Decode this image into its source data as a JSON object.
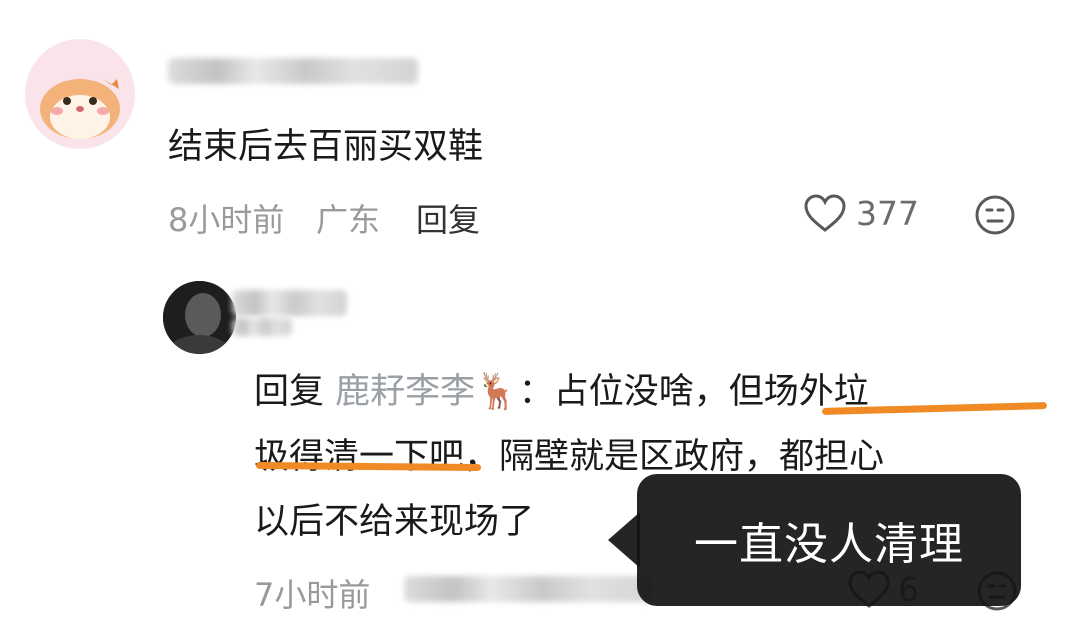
{
  "comment1": {
    "text": "结束后去百丽买双鞋",
    "time": "8小时前",
    "location": "广东",
    "reply_label": "回复",
    "like_count": "377"
  },
  "comment2": {
    "reply_prefix": "回复",
    "mention": "鹿耔李李🦌",
    "colon": "：",
    "line1_rest": "占位没啥，但场外垃",
    "line2": "圾得清一下吧，隔壁就是区政府，都担心",
    "line3": "以后不给来现场了",
    "time": "7小时前",
    "like_count": "6"
  },
  "overlay": {
    "bubble_text": "一直没人清理"
  },
  "colors": {
    "annotation": "#f08a24",
    "meta": "#9a9a9a",
    "bubble": "#121212"
  },
  "icons": [
    "heart-icon",
    "emoji-neutral-icon",
    "heart-icon",
    "emoji-neutral-icon"
  ]
}
